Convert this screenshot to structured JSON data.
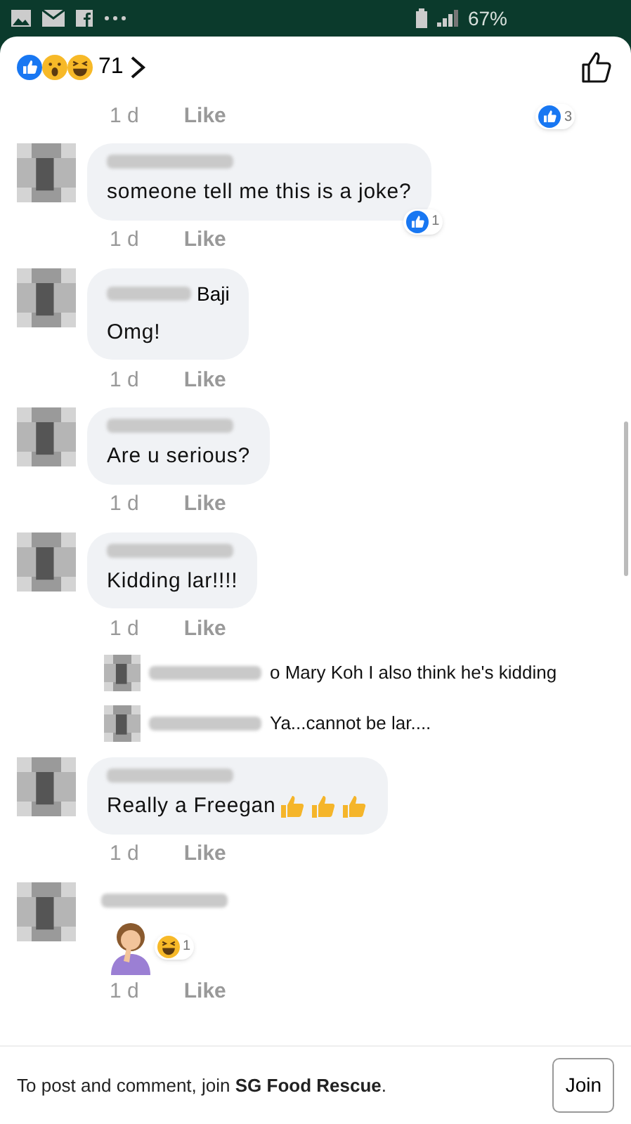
{
  "status_bar": {
    "battery": "67%"
  },
  "header": {
    "reactions": [
      {
        "kind": "like"
      },
      {
        "kind": "wow"
      },
      {
        "kind": "haha"
      }
    ],
    "reaction_count": "71"
  },
  "comments": [
    {
      "kind": "partial",
      "time": "1 d",
      "like": "Like",
      "reactions": [
        {
          "kind": "like",
          "count": "3"
        }
      ]
    },
    {
      "kind": "comment",
      "text": "someone tell me this is a joke?",
      "time": "1 d",
      "like": "Like",
      "reactions": [
        {
          "kind": "like",
          "count": "1"
        }
      ]
    },
    {
      "kind": "comment",
      "name_suffix": "Baji",
      "text": "Omg!",
      "time": "1 d",
      "like": "Like"
    },
    {
      "kind": "comment",
      "text": "Are u serious?",
      "time": "1 d",
      "like": "Like"
    },
    {
      "kind": "comment",
      "text": "Kidding lar!!!!",
      "time": "1 d",
      "like": "Like"
    },
    {
      "kind": "reply",
      "text": "o Mary Koh I also think he's kidding"
    },
    {
      "kind": "reply",
      "text": "Ya...cannot be lar...."
    },
    {
      "kind": "comment",
      "text": "Really a Freegan",
      "emojis": [
        {
          "kind": "thumbs_up"
        },
        {
          "kind": "thumbs_up"
        },
        {
          "kind": "thumbs_up"
        }
      ],
      "time": "1 d",
      "like": "Like"
    },
    {
      "kind": "sticker",
      "time": "1 d",
      "like": "Like",
      "reactions": [
        {
          "kind": "haha",
          "count": "1"
        }
      ]
    }
  ],
  "footer": {
    "text": "To post and comment, join **SG Food Rescue**.",
    "button": "Join"
  }
}
